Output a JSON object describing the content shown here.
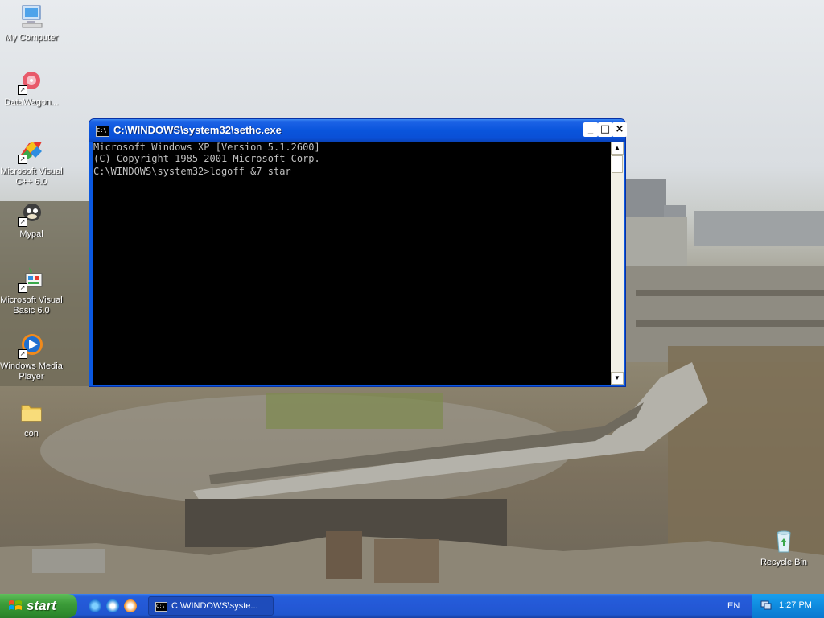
{
  "desktop": {
    "icons": [
      {
        "label": "My Computer",
        "icon": "my-computer-icon"
      },
      {
        "label": "DataWagon...",
        "icon": "datawagon-icon"
      },
      {
        "label": "Microsoft Visual C++ 6.0",
        "icon": "visual-cpp-icon"
      },
      {
        "label": "Mypal",
        "icon": "mypal-icon"
      },
      {
        "label": "Microsoft Visual Basic 6.0",
        "icon": "visual-basic-icon"
      },
      {
        "label": "Windows Media Player",
        "icon": "media-player-icon"
      },
      {
        "label": "con",
        "icon": "folder-icon"
      },
      {
        "label": "Recycle Bin",
        "icon": "recycle-bin-icon"
      }
    ]
  },
  "window": {
    "title": "C:\\WINDOWS\\system32\\sethc.exe",
    "console_lines": [
      "Microsoft Windows XP [Version 5.1.2600]",
      "(C) Copyright 1985-2001 Microsoft Corp.",
      "",
      "C:\\WINDOWS\\system32>logoff &7 star"
    ],
    "minimize": "_",
    "maximize": "□",
    "close": "×"
  },
  "taskbar": {
    "start_label": "start",
    "task_label": "C:\\WINDOWS\\syste...",
    "language": "EN",
    "clock": "1:27 PM"
  }
}
